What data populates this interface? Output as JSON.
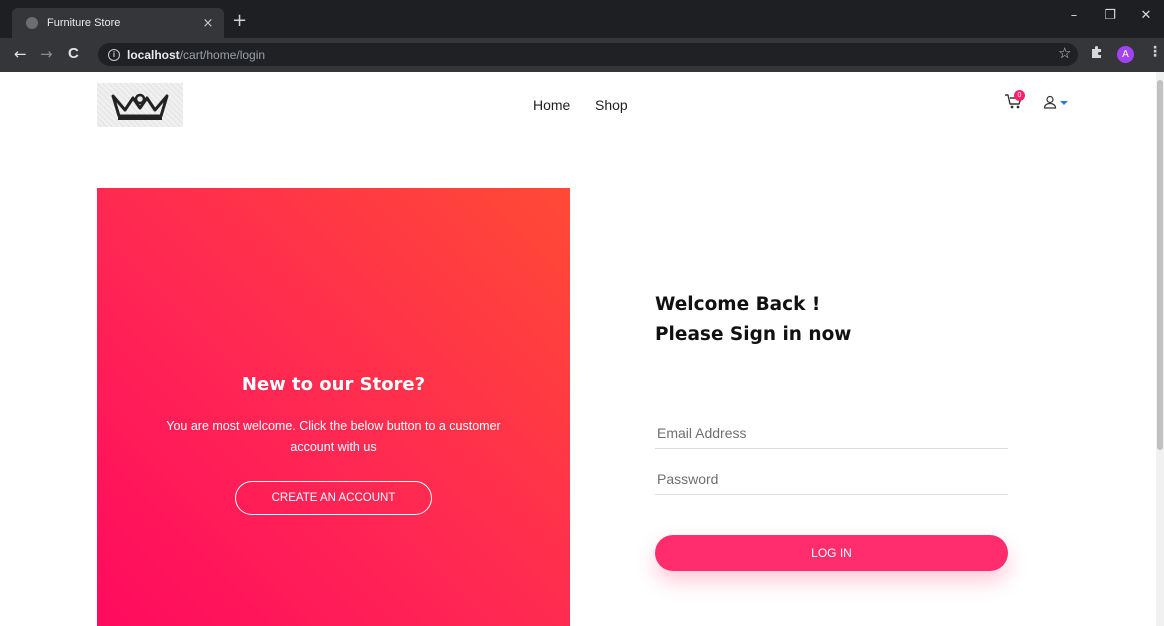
{
  "browser": {
    "tab_title": "Furniture Store",
    "tab_close": "×",
    "new_tab": "+",
    "url_host": "localhost",
    "url_path": "/cart/home/login",
    "back": "←",
    "forward": "→",
    "reload": "C",
    "info": "i",
    "star": "☆",
    "menu": "⋮",
    "profile_initial": "A",
    "window_controls": {
      "minimize": "–",
      "restore": "❐",
      "close": "✕"
    },
    "icons": [
      "globe-icon",
      "info-icon",
      "star-icon",
      "puzzle-icon",
      "avatar",
      "menu-icon"
    ]
  },
  "site": {
    "nav": {
      "home": "Home",
      "shop": "Shop"
    },
    "cart_count": "0",
    "icons": [
      "crown-logo",
      "cart-icon",
      "user-icon",
      "caret-down-icon"
    ]
  },
  "promo": {
    "heading": "New to our Store?",
    "text": "You are most welcome. Click the below button to a customer account with us",
    "button": "CREATE AN ACCOUNT",
    "gradient": [
      "#ff0a5f",
      "#ff4a35"
    ]
  },
  "login": {
    "title_line1": "Welcome Back !",
    "title_line2": "Please Sign in now",
    "email_placeholder": "Email Address",
    "password_placeholder": "Password",
    "button": "LOG IN",
    "accent": "#ff2d6d"
  }
}
